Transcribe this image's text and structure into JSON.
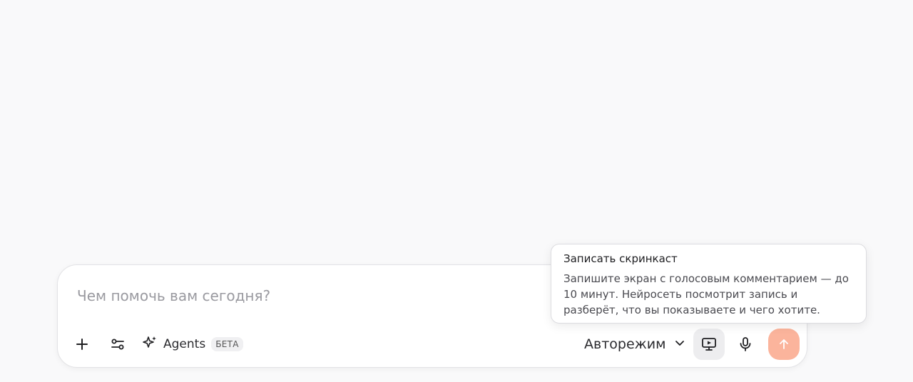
{
  "composer": {
    "placeholder": "Чем помочь вам сегодня?",
    "value": ""
  },
  "toolbar": {
    "add_icon": "plus-icon",
    "tools_icon": "sliders-icon",
    "agents_icon": "sparkles-icon",
    "agents_label": "Agents",
    "beta_badge": "БЕТА",
    "mode_label": "Авторежим",
    "mode_icon": "chevron-down-icon",
    "screencast_icon": "screen-record-icon",
    "mic_icon": "microphone-icon",
    "send_icon": "arrow-up-icon"
  },
  "tooltip": {
    "title": "Записать скринкаст",
    "body": "Запишите экран с голосовым комментарием — до 10 минут. Нейросеть посмотрит запись и разберёт, что вы показываете и чего хотите."
  },
  "colors": {
    "background": "#f9f9fa",
    "send_button": "#fbb49c",
    "text": "#2a2a2e",
    "placeholder": "#9a9aa0"
  }
}
